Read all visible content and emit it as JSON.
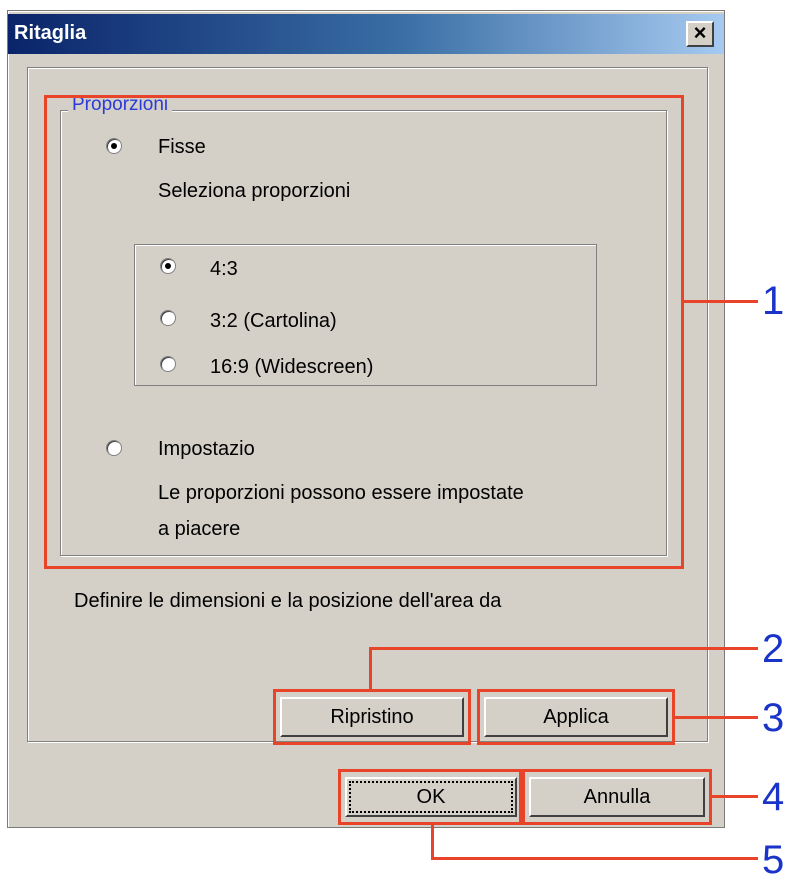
{
  "window": {
    "title": "Ritaglia"
  },
  "group": {
    "legend": "Proporzioni",
    "fixed": {
      "label": "Fisse",
      "selected": true,
      "hint": "Seleziona proporzioni"
    },
    "ratios": [
      {
        "label": "4:3",
        "selected": true
      },
      {
        "label": "3:2 (Cartolina)",
        "selected": false
      },
      {
        "label": "16:9 (Widescreen)",
        "selected": false
      }
    ],
    "custom": {
      "label": "Impostazio",
      "selected": false,
      "hint_line1": "Le proporzioni possono essere impostate",
      "hint_line2": "a piacere"
    }
  },
  "instruction": "Definire le dimensioni e la posizione dell'area da",
  "buttons": {
    "reset": "Ripristino",
    "apply": "Applica",
    "ok": "OK",
    "cancel": "Annulla"
  },
  "callouts": [
    "1",
    "2",
    "3",
    "4",
    "5"
  ],
  "colors": {
    "callout_box": "#e8442a",
    "callout_number": "#1a33c8",
    "title_bar": "#0a246a"
  }
}
